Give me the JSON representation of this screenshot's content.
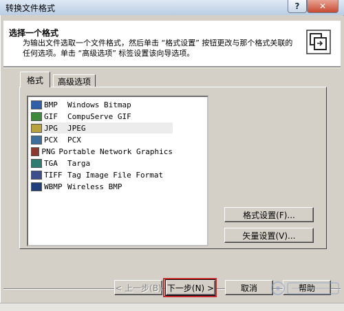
{
  "window": {
    "title": "转换文件格式",
    "help_glyph": "?",
    "close_glyph": "✕"
  },
  "header": {
    "title": "选择一个格式",
    "description": "为输出文件选取一个文件格式，然后单击 “格式设置” 按钮更改与那个格式关联的任何选项。单击 “高级选项” 标签设置该向导选项。"
  },
  "tabs": [
    {
      "label": "格式"
    },
    {
      "label": "高级选项"
    }
  ],
  "formats": [
    {
      "ext": "BMP",
      "desc": "Windows Bitmap",
      "icon": "bmp-icon",
      "color": "#2f5fa8"
    },
    {
      "ext": "GIF",
      "desc": "CompuServe GIF",
      "icon": "gif-icon",
      "color": "#3d8a3a"
    },
    {
      "ext": "JPG",
      "desc": "JPEG",
      "icon": "jpg-icon",
      "color": "#b9a13b",
      "selected": true
    },
    {
      "ext": "PCX",
      "desc": "PCX",
      "icon": "pcx-icon",
      "color": "#3e6f9a"
    },
    {
      "ext": "PNG",
      "desc": "Portable Network Graphics",
      "icon": "png-icon",
      "color": "#8c3a2e"
    },
    {
      "ext": "TGA",
      "desc": "Targa",
      "icon": "tga-icon",
      "color": "#2e7d72"
    },
    {
      "ext": "TIFF",
      "desc": "Tag Image File Format",
      "icon": "tiff-icon",
      "color": "#3b4f8c"
    },
    {
      "ext": "WBMP",
      "desc": "Wireless BMP",
      "icon": "wbmp-icon",
      "color": "#1f3f7a"
    }
  ],
  "buttons": {
    "format_settings": "格式设置(F)...",
    "vector_settings": "矢量设置(V)...",
    "back": "< 上一步(B)",
    "next": "下一步(N) >",
    "cancel": "取消",
    "help": "帮助"
  },
  "colors": {
    "highlight": "#c92b2b",
    "window_bg": "#d4d0c8"
  }
}
